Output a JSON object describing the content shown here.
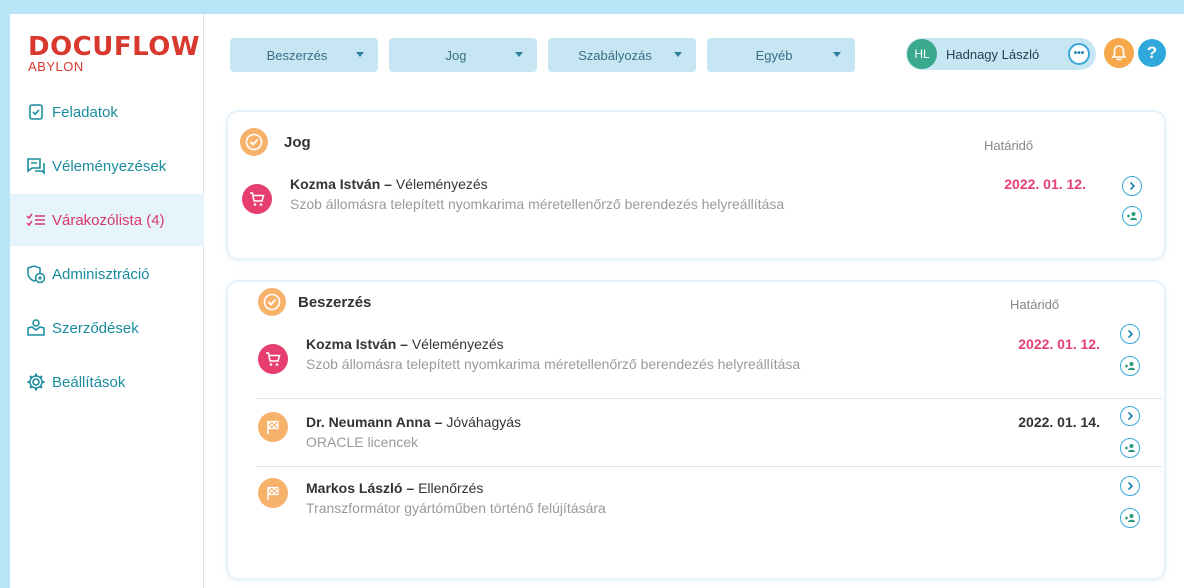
{
  "app": {
    "logo_main": "DOCUFLOW",
    "logo_sub": "ABYLON"
  },
  "sidebar": {
    "items": [
      {
        "label": "Feladatok",
        "icon": "document-check-icon"
      },
      {
        "label": "Véleményezések",
        "icon": "comments-icon"
      },
      {
        "label": "Várakozólista (4)",
        "icon": "checklist-icon",
        "active": true
      },
      {
        "label": "Adminisztráció",
        "icon": "admin-icon"
      },
      {
        "label": "Szerződések",
        "icon": "contract-icon"
      },
      {
        "label": "Beállítások",
        "icon": "gear-icon"
      }
    ]
  },
  "topbar": {
    "dropdowns": [
      "Beszerzés",
      "Jog",
      "Szabályozás",
      "Egyéb"
    ],
    "user_initials": "HL",
    "user_name": "Hadnagy László"
  },
  "colors": {
    "accent": "#2fa8dc",
    "active": "#d9386a",
    "overdue": "#e63f6f",
    "category": "#f6b26b"
  },
  "cards": [
    {
      "title": "Jog",
      "deadline_header": "Határidő",
      "rows": [
        {
          "person": "Kozma István",
          "action": "Véleményezés",
          "subject": "Szob állomásra telepített nyomkarima méretellenőrző berendezés helyreállítása",
          "date": "2022. 01. 12.",
          "icon": "cart-icon",
          "overdue": true
        }
      ]
    },
    {
      "title": "Beszerzés",
      "deadline_header": "Határidő",
      "rows": [
        {
          "person": "Kozma István",
          "action": "Véleményezés",
          "subject": "Szob állomásra telepített nyomkarima méretellenőrző berendezés helyreállítása",
          "date": "2022. 01. 12.",
          "icon": "cart-icon",
          "overdue": true
        },
        {
          "person": "Dr. Neumann Anna",
          "action": "Jóváhagyás",
          "subject": "ORACLE licencek",
          "date": "2022. 01. 14.",
          "icon": "flag-icon",
          "overdue": false
        },
        {
          "person": "Markos László",
          "action": "Ellenőrzés",
          "subject": "Transzformátor gyártóműben történő felújítására",
          "date": "",
          "icon": "flag-icon",
          "overdue": false
        }
      ]
    }
  ]
}
